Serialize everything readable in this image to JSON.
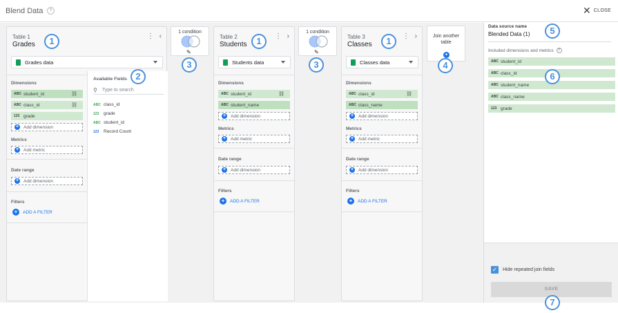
{
  "header": {
    "title": "Blend Data",
    "help": "?",
    "close_icon": "✕",
    "close_label": "CLOSE"
  },
  "tables": [
    {
      "number": "Table 1",
      "name": "Grades",
      "datasource": "Grades data",
      "dimensions_title": "Dimensions",
      "dimensions": [
        {
          "type": "ABC",
          "label": "student_id",
          "link": true
        },
        {
          "type": "ABC",
          "label": "class_id",
          "link": true
        },
        {
          "type": "123",
          "label": "grade",
          "link": false
        }
      ],
      "add_dimension": "Add dimension",
      "metrics_title": "Metrics",
      "add_metric": "Add metric",
      "daterange_title": "Date range",
      "add_daterange": "Add dimension",
      "filters_title": "Filters",
      "add_filter": "ADD A FILTER"
    },
    {
      "number": "Table 2",
      "name": "Students",
      "datasource": "Students data",
      "dimensions_title": "Dimensions",
      "dimensions": [
        {
          "type": "ABC",
          "label": "student_id",
          "link": true
        },
        {
          "type": "ABC",
          "label": "student_name",
          "link": false
        }
      ],
      "add_dimension": "Add dimension",
      "metrics_title": "Metrics",
      "add_metric": "Add metric",
      "daterange_title": "Date range",
      "add_daterange": "Add dimension",
      "filters_title": "Filters",
      "add_filter": "ADD A FILTER"
    },
    {
      "number": "Table 3",
      "name": "Classes",
      "datasource": "Classes data",
      "dimensions_title": "Dimensions",
      "dimensions": [
        {
          "type": "ABC",
          "label": "class_id",
          "link": true
        },
        {
          "type": "ABC",
          "label": "class_name",
          "link": false
        }
      ],
      "add_dimension": "Add dimension",
      "metrics_title": "Metrics",
      "add_metric": "Add metric",
      "daterange_title": "Date range",
      "add_daterange": "Add dimension",
      "filters_title": "Filters",
      "add_filter": "ADD A FILTER"
    }
  ],
  "available_fields": {
    "title": "Available Fields",
    "search_placeholder": "Type to search",
    "fields": [
      {
        "type": "ABC",
        "label": "class_id",
        "color": "#34a853"
      },
      {
        "type": "123",
        "label": "grade",
        "color": "#34a853"
      },
      {
        "type": "ABC",
        "label": "student_id",
        "color": "#34a853"
      },
      {
        "type": "123",
        "label": "Record Count",
        "color": "#1a73e8"
      }
    ]
  },
  "joins": [
    {
      "label": "1 condition"
    },
    {
      "label": "1 condition"
    }
  ],
  "join_another": {
    "label": "Join another table"
  },
  "badges": [
    "1",
    "1",
    "1",
    "2",
    "3",
    "3",
    "4",
    "5",
    "6",
    "7"
  ],
  "right_panel": {
    "ds_label": "Data source name",
    "ds_name": "Blended Data (1)",
    "included_label": "Included dimensions and metrics",
    "included": [
      {
        "type": "ABC",
        "label": "student_id"
      },
      {
        "type": "ABC",
        "label": "class_id"
      },
      {
        "type": "ABC",
        "label": "student_name"
      },
      {
        "type": "ABC",
        "label": "class_name"
      },
      {
        "type": "123",
        "label": "grade"
      }
    ],
    "hide_repeated": "Hide repeated join fields",
    "save": "SAVE"
  },
  "colors": {
    "accent": "#1a73e8",
    "badge": "#4a90d9",
    "chip": "#cfe8cf",
    "sheet": "#0f9d58"
  }
}
